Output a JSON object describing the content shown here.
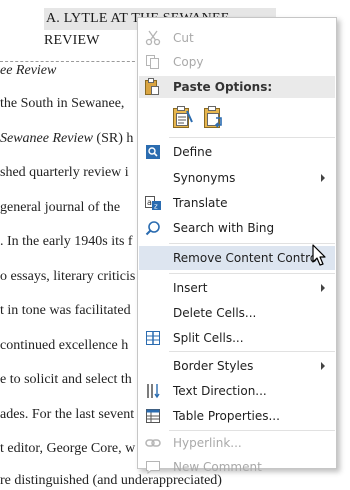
{
  "document": {
    "heading": "A. LYTLE AT THE SEWANEE REVIEW",
    "lines": [
      "ee Review",
      "the South in Sewanee,",
      "Sewanee Review (SR) h",
      "shed quarterly review i",
      "general journal of the",
      ". In the early 1940s its f",
      "o essays, literary criticis",
      "t in tone was facilitated",
      "continued excellence h",
      "e to solicit and select th",
      "ades. For the last sevent",
      "t editor, George Core, w",
      "re distinguished (and underappreciated)"
    ]
  },
  "context_menu": {
    "cut": "Cut",
    "copy": "Copy",
    "paste_options": "Paste Options:",
    "define": "Define",
    "synonyms": "Synonyms",
    "translate": "Translate",
    "search_with_bing": "Search with Bing",
    "remove_content_control": "Remove Content Control",
    "insert": "Insert",
    "delete_cells": "Delete Cells...",
    "split_cells": "Split Cells...",
    "border_styles": "Border Styles",
    "text_direction": "Text Direction...",
    "table_properties": "Table Properties...",
    "hyperlink": "Hyperlink...",
    "new_comment": "New Comment"
  },
  "colors": {
    "hover_highlight": "#dde5f0",
    "icon_blue": "#2b6cb0",
    "disabled_text": "#a9a9a9"
  }
}
